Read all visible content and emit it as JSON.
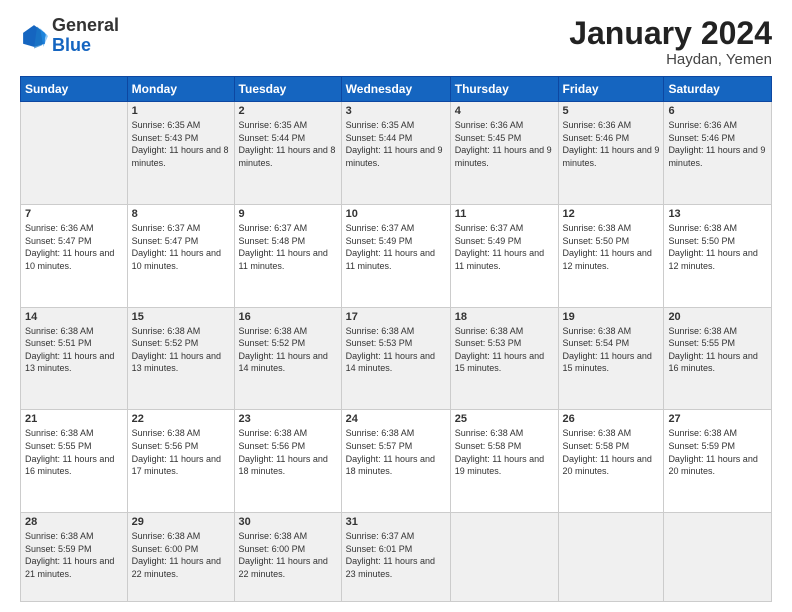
{
  "header": {
    "logo_general": "General",
    "logo_blue": "Blue",
    "month_title": "January 2024",
    "location": "Haydan, Yemen"
  },
  "days_of_week": [
    "Sunday",
    "Monday",
    "Tuesday",
    "Wednesday",
    "Thursday",
    "Friday",
    "Saturday"
  ],
  "weeks": [
    [
      {
        "day": "",
        "sunrise": "",
        "sunset": "",
        "daylight": ""
      },
      {
        "day": "1",
        "sunrise": "Sunrise: 6:35 AM",
        "sunset": "Sunset: 5:43 PM",
        "daylight": "Daylight: 11 hours and 8 minutes."
      },
      {
        "day": "2",
        "sunrise": "Sunrise: 6:35 AM",
        "sunset": "Sunset: 5:44 PM",
        "daylight": "Daylight: 11 hours and 8 minutes."
      },
      {
        "day": "3",
        "sunrise": "Sunrise: 6:35 AM",
        "sunset": "Sunset: 5:44 PM",
        "daylight": "Daylight: 11 hours and 9 minutes."
      },
      {
        "day": "4",
        "sunrise": "Sunrise: 6:36 AM",
        "sunset": "Sunset: 5:45 PM",
        "daylight": "Daylight: 11 hours and 9 minutes."
      },
      {
        "day": "5",
        "sunrise": "Sunrise: 6:36 AM",
        "sunset": "Sunset: 5:46 PM",
        "daylight": "Daylight: 11 hours and 9 minutes."
      },
      {
        "day": "6",
        "sunrise": "Sunrise: 6:36 AM",
        "sunset": "Sunset: 5:46 PM",
        "daylight": "Daylight: 11 hours and 9 minutes."
      }
    ],
    [
      {
        "day": "7",
        "sunrise": "Sunrise: 6:36 AM",
        "sunset": "Sunset: 5:47 PM",
        "daylight": "Daylight: 11 hours and 10 minutes."
      },
      {
        "day": "8",
        "sunrise": "Sunrise: 6:37 AM",
        "sunset": "Sunset: 5:47 PM",
        "daylight": "Daylight: 11 hours and 10 minutes."
      },
      {
        "day": "9",
        "sunrise": "Sunrise: 6:37 AM",
        "sunset": "Sunset: 5:48 PM",
        "daylight": "Daylight: 11 hours and 11 minutes."
      },
      {
        "day": "10",
        "sunrise": "Sunrise: 6:37 AM",
        "sunset": "Sunset: 5:49 PM",
        "daylight": "Daylight: 11 hours and 11 minutes."
      },
      {
        "day": "11",
        "sunrise": "Sunrise: 6:37 AM",
        "sunset": "Sunset: 5:49 PM",
        "daylight": "Daylight: 11 hours and 11 minutes."
      },
      {
        "day": "12",
        "sunrise": "Sunrise: 6:38 AM",
        "sunset": "Sunset: 5:50 PM",
        "daylight": "Daylight: 11 hours and 12 minutes."
      },
      {
        "day": "13",
        "sunrise": "Sunrise: 6:38 AM",
        "sunset": "Sunset: 5:50 PM",
        "daylight": "Daylight: 11 hours and 12 minutes."
      }
    ],
    [
      {
        "day": "14",
        "sunrise": "Sunrise: 6:38 AM",
        "sunset": "Sunset: 5:51 PM",
        "daylight": "Daylight: 11 hours and 13 minutes."
      },
      {
        "day": "15",
        "sunrise": "Sunrise: 6:38 AM",
        "sunset": "Sunset: 5:52 PM",
        "daylight": "Daylight: 11 hours and 13 minutes."
      },
      {
        "day": "16",
        "sunrise": "Sunrise: 6:38 AM",
        "sunset": "Sunset: 5:52 PM",
        "daylight": "Daylight: 11 hours and 14 minutes."
      },
      {
        "day": "17",
        "sunrise": "Sunrise: 6:38 AM",
        "sunset": "Sunset: 5:53 PM",
        "daylight": "Daylight: 11 hours and 14 minutes."
      },
      {
        "day": "18",
        "sunrise": "Sunrise: 6:38 AM",
        "sunset": "Sunset: 5:53 PM",
        "daylight": "Daylight: 11 hours and 15 minutes."
      },
      {
        "day": "19",
        "sunrise": "Sunrise: 6:38 AM",
        "sunset": "Sunset: 5:54 PM",
        "daylight": "Daylight: 11 hours and 15 minutes."
      },
      {
        "day": "20",
        "sunrise": "Sunrise: 6:38 AM",
        "sunset": "Sunset: 5:55 PM",
        "daylight": "Daylight: 11 hours and 16 minutes."
      }
    ],
    [
      {
        "day": "21",
        "sunrise": "Sunrise: 6:38 AM",
        "sunset": "Sunset: 5:55 PM",
        "daylight": "Daylight: 11 hours and 16 minutes."
      },
      {
        "day": "22",
        "sunrise": "Sunrise: 6:38 AM",
        "sunset": "Sunset: 5:56 PM",
        "daylight": "Daylight: 11 hours and 17 minutes."
      },
      {
        "day": "23",
        "sunrise": "Sunrise: 6:38 AM",
        "sunset": "Sunset: 5:56 PM",
        "daylight": "Daylight: 11 hours and 18 minutes."
      },
      {
        "day": "24",
        "sunrise": "Sunrise: 6:38 AM",
        "sunset": "Sunset: 5:57 PM",
        "daylight": "Daylight: 11 hours and 18 minutes."
      },
      {
        "day": "25",
        "sunrise": "Sunrise: 6:38 AM",
        "sunset": "Sunset: 5:58 PM",
        "daylight": "Daylight: 11 hours and 19 minutes."
      },
      {
        "day": "26",
        "sunrise": "Sunrise: 6:38 AM",
        "sunset": "Sunset: 5:58 PM",
        "daylight": "Daylight: 11 hours and 20 minutes."
      },
      {
        "day": "27",
        "sunrise": "Sunrise: 6:38 AM",
        "sunset": "Sunset: 5:59 PM",
        "daylight": "Daylight: 11 hours and 20 minutes."
      }
    ],
    [
      {
        "day": "28",
        "sunrise": "Sunrise: 6:38 AM",
        "sunset": "Sunset: 5:59 PM",
        "daylight": "Daylight: 11 hours and 21 minutes."
      },
      {
        "day": "29",
        "sunrise": "Sunrise: 6:38 AM",
        "sunset": "Sunset: 6:00 PM",
        "daylight": "Daylight: 11 hours and 22 minutes."
      },
      {
        "day": "30",
        "sunrise": "Sunrise: 6:38 AM",
        "sunset": "Sunset: 6:00 PM",
        "daylight": "Daylight: 11 hours and 22 minutes."
      },
      {
        "day": "31",
        "sunrise": "Sunrise: 6:37 AM",
        "sunset": "Sunset: 6:01 PM",
        "daylight": "Daylight: 11 hours and 23 minutes."
      },
      {
        "day": "",
        "sunrise": "",
        "sunset": "",
        "daylight": ""
      },
      {
        "day": "",
        "sunrise": "",
        "sunset": "",
        "daylight": ""
      },
      {
        "day": "",
        "sunrise": "",
        "sunset": "",
        "daylight": ""
      }
    ]
  ],
  "alt_rows": [
    0,
    2,
    4
  ],
  "colors": {
    "header_bg": "#1565c0",
    "alt_row_bg": "#f0f0f0",
    "normal_row_bg": "#ffffff"
  }
}
